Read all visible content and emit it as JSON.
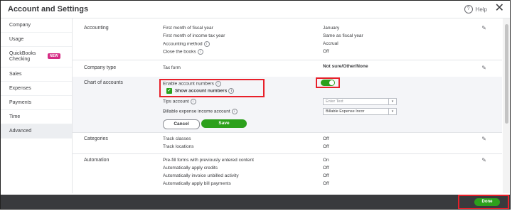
{
  "header": {
    "title": "Account and Settings",
    "help_label": "Help",
    "help_icon": "?",
    "close_icon": "✕"
  },
  "sidebar": {
    "items": [
      {
        "label": "Company"
      },
      {
        "label": "Usage"
      },
      {
        "label": "QuickBooks Checking",
        "badge": "NEW"
      },
      {
        "label": "Sales"
      },
      {
        "label": "Expenses"
      },
      {
        "label": "Payments"
      },
      {
        "label": "Time"
      },
      {
        "label": "Advanced"
      }
    ]
  },
  "accounting": {
    "title": "Accounting",
    "rows": [
      {
        "label": "First month of fiscal year",
        "value": "January"
      },
      {
        "label": "First month of income tax year",
        "value": "Same as fiscal year"
      },
      {
        "label": "Accounting method",
        "value": "Accrual"
      },
      {
        "label": "Close the books",
        "value": "Off"
      }
    ]
  },
  "company_type": {
    "title": "Company type",
    "label": "Tax form",
    "value": "Not sure/Other/None"
  },
  "chart_of_accounts": {
    "title": "Chart of accounts",
    "enable_label": "Enable account numbers",
    "show_label": "Show account numbers",
    "tips_label": "Tips account",
    "tips_placeholder": "Enter Text",
    "billable_label": "Billable expense income account",
    "billable_value": "Billable Expense Incor",
    "cancel_label": "Cancel",
    "save_label": "Save",
    "check_glyph": "✓",
    "caret_glyph": "▾",
    "enabled": true
  },
  "categories": {
    "title": "Categories",
    "rows": [
      {
        "label": "Track classes",
        "value": "Off"
      },
      {
        "label": "Track locations",
        "value": "Off"
      }
    ]
  },
  "automation": {
    "title": "Automation",
    "rows": [
      {
        "label": "Pre-fill forms with previously entered content",
        "value": "On"
      },
      {
        "label": "Automatically apply credits",
        "value": "Off"
      },
      {
        "label": "Automatically invoice unbilled activity",
        "value": "Off"
      },
      {
        "label": "Automatically apply bill payments",
        "value": "Off"
      }
    ]
  },
  "footer": {
    "done_label": "Done"
  },
  "icons": {
    "info": "i",
    "pencil": "✎"
  },
  "colors": {
    "accent_green": "#2ca01c",
    "highlight_red": "#e8202a",
    "footer_bg": "#393a3d",
    "badge_pink": "#d52b84"
  }
}
